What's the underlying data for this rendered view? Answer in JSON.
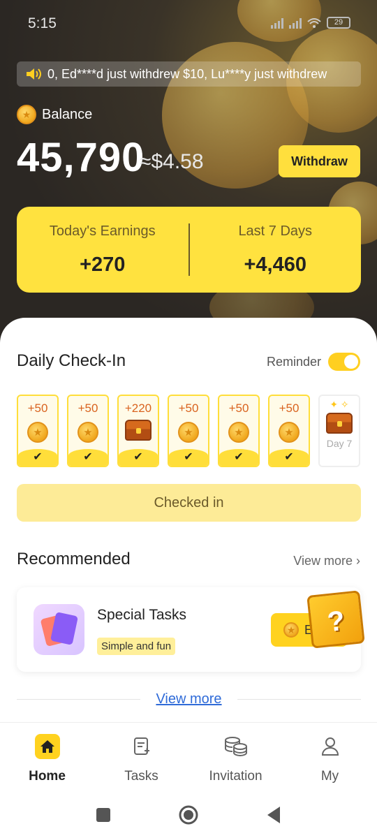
{
  "status_bar": {
    "time": "5:15",
    "battery": "29"
  },
  "ticker": {
    "text": "0, Ed****d just withdrew $10, Lu****y just withdrew"
  },
  "balance": {
    "label": "Balance",
    "value": "45,790",
    "approx": "≈$4.58",
    "withdraw_label": "Withdraw"
  },
  "earnings": {
    "today_label": "Today's Earnings",
    "today_value": "+270",
    "week_label": "Last 7 Days",
    "week_value": "+4,460"
  },
  "checkin": {
    "title": "Daily Check-In",
    "reminder_label": "Reminder",
    "reminder_on": true,
    "days": [
      {
        "amount": "+50",
        "reward": "coin",
        "checked": true
      },
      {
        "amount": "+50",
        "reward": "coin",
        "checked": true
      },
      {
        "amount": "+220",
        "reward": "chest",
        "checked": true
      },
      {
        "amount": "+50",
        "reward": "coin",
        "checked": true
      },
      {
        "amount": "+50",
        "reward": "coin",
        "checked": true
      },
      {
        "amount": "+50",
        "reward": "coin",
        "checked": true
      },
      {
        "label": "Day 7",
        "reward": "chest",
        "checked": false
      }
    ],
    "button_label": "Checked in"
  },
  "recommended": {
    "title": "Recommended",
    "view_more": "View more",
    "task": {
      "title": "Special Tasks",
      "tag": "Simple and fun",
      "button_label": "E"
    },
    "bottom_link": "View more"
  },
  "nav": {
    "items": [
      {
        "label": "Home",
        "icon": "home-icon",
        "active": true
      },
      {
        "label": "Tasks",
        "icon": "tasks-icon",
        "active": false
      },
      {
        "label": "Invitation",
        "icon": "coins-stack-icon",
        "active": false
      },
      {
        "label": "My",
        "icon": "person-icon",
        "active": false
      }
    ]
  },
  "colors": {
    "accent": "#ffd21f",
    "card_yellow": "#ffe23f",
    "dark_bg": "#2b2723",
    "link": "#2f6bd8"
  }
}
